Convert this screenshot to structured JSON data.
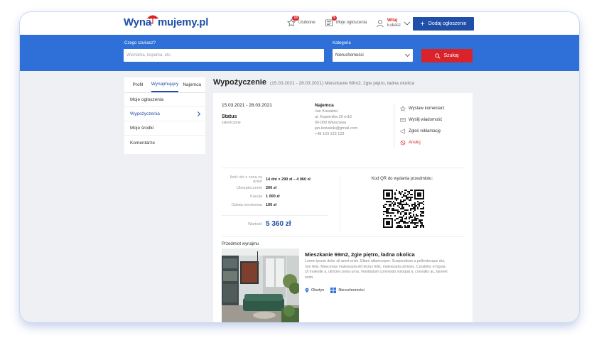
{
  "logo": {
    "part1": "Wyna",
    "part2": "mujemy.pl"
  },
  "header": {
    "favorites_label": "Ulubione",
    "favorites_count": "15",
    "my_ads_label": "Moje ogłoszenia",
    "my_ads_count": "5",
    "greeting": "Witaj",
    "user_name": "Łukasz",
    "add_button": "Dodaj ogłoszenie"
  },
  "search": {
    "query_label": "Czego szukasz?",
    "query_placeholder": "Wiertarka, koparka, etc.",
    "category_label": "Kategoria",
    "category_value": "Nieruchomości",
    "search_button": "Szukaj"
  },
  "sidebar": {
    "tabs": [
      "Profil",
      "Wynajmujący",
      "Najemca"
    ],
    "active_tab": "Wynajmujący",
    "items": [
      "Moje ogłoszenia",
      "Wypożyczenia",
      "Moje środki",
      "Komentarze"
    ],
    "active_item": "Wypożyczenia"
  },
  "page": {
    "title": "Wypożyczenie",
    "subtitle": "(15.03.2021 - 28.03.2021) Mieszkanie 69m2, 2gie piętro, ładna okolica"
  },
  "rental": {
    "dates": "15.03.2021 - 28.03.2021",
    "status_label": "Status",
    "status_value": "zakończone",
    "tenant_label": "Najemca",
    "tenant_name": "Jan Kowalski",
    "tenant_street": "ul. Kopernika 20 m10",
    "tenant_city": "00-000 Warszawa",
    "tenant_email": "jan.kowalski@gmail.com",
    "tenant_phone": "+48 123 123 123",
    "actions": [
      "Wystaw komentarz",
      "Wyślij wiadomość",
      "Zgłoś reklamację",
      "Anuluj"
    ]
  },
  "costs": {
    "rows": [
      {
        "label": "Ilość dni x cena za dzień",
        "value": "14 dni × 290 zł – 4 060 zł"
      },
      {
        "label": "Ubezpieczenie",
        "value": "200 zł"
      },
      {
        "label": "Kaucja",
        "value": "1 000 zł"
      },
      {
        "label": "Opłata serwisowa",
        "value": "100 zł"
      }
    ],
    "total_label": "Wartość",
    "total_value": "5 360 zł"
  },
  "qr": {
    "label": "Kod QR do wydania przedmiotu:"
  },
  "item": {
    "section_label": "Przedmiot wynajmu",
    "title": "Mieszkanie 69m2, 2gie piętro, ładna okolica",
    "description": "Lorem ipsum dolor sit amet enim. Etiam ullamcorper. Suspendisse a pellentesque dui, non felis. Maecenas malesuada elit lectus felis, malesuada ultricies. Curabitur et ligula. Ut molestie a, ultricies porta urna. Vestibulum commodo volutpat a, convallis ac, laoreet enim.",
    "location": "Olsztyn",
    "category": "Nieruchomości"
  },
  "colors": {
    "brand": "#1f4fa8",
    "band": "#2e6fd8",
    "danger": "#d8232a"
  }
}
